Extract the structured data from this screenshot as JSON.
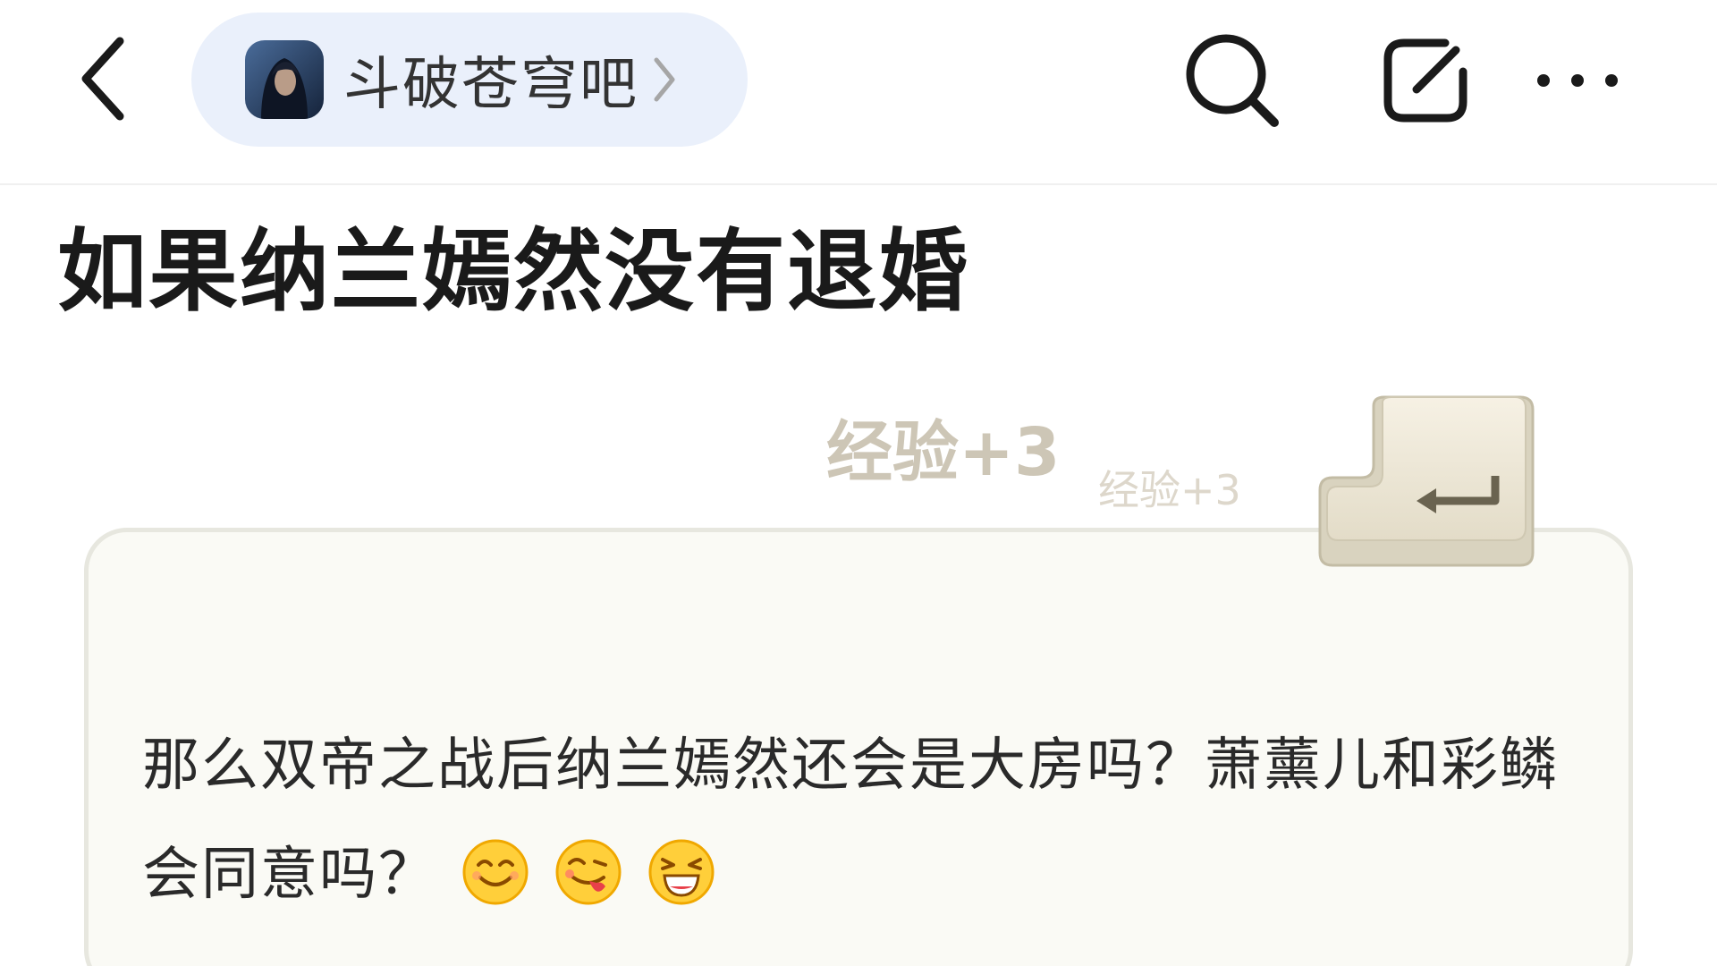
{
  "header": {
    "forum_name": "斗破苍穹吧",
    "icons": {
      "back": "chevron-left-icon",
      "forward": "chevron-right-icon",
      "search": "search-icon",
      "share": "share-icon",
      "more": "more-dots-icon"
    }
  },
  "post": {
    "title": "如果纳兰嫣然没有退婚",
    "content": "那么双帝之战后纳兰嫣然还会是大房吗？萧薰儿和彩鳞会同意吗？",
    "emojis": [
      "smile-emoji",
      "tongue-emoji",
      "laugh-emoji"
    ]
  },
  "experience": {
    "large_label": "经验+3",
    "small_label": "经验+3"
  },
  "colors": {
    "pill_bg": "#eaf0fb",
    "card_bg": "#fafaf5",
    "exp_text": "#cdc6b6",
    "emoji_yellow": "#ffcf3a"
  }
}
